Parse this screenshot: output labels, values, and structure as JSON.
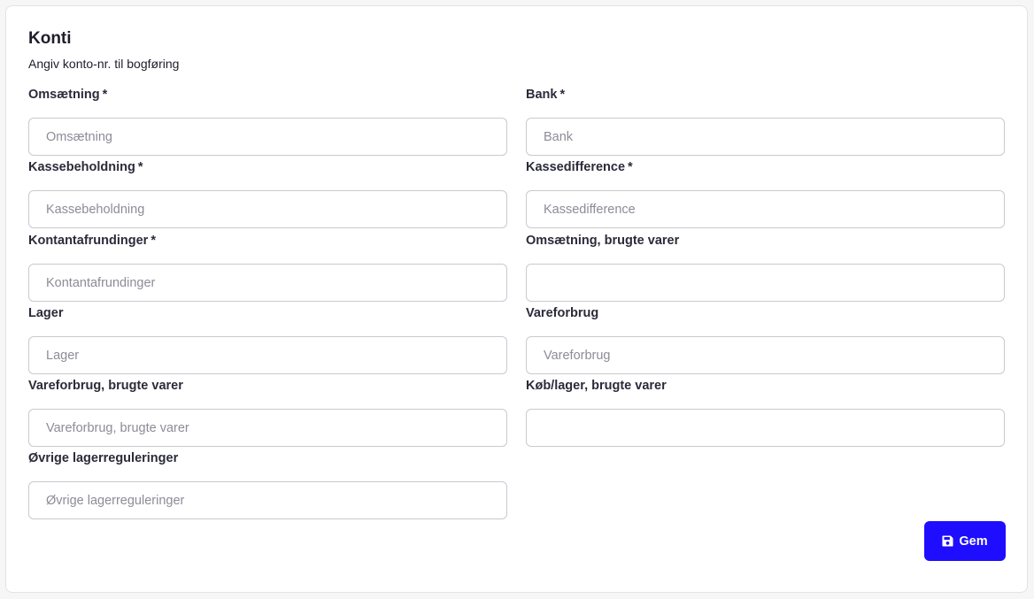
{
  "card": {
    "title": "Konti",
    "subtitle": "Angiv konto-nr. til bogføring"
  },
  "fields": {
    "omsaetning": {
      "label": "Omsætning",
      "required_mark": "*",
      "value": "",
      "placeholder": "Omsætning"
    },
    "bank": {
      "label": "Bank",
      "required_mark": "*",
      "value": "",
      "placeholder": "Bank"
    },
    "kassebeholdning": {
      "label": "Kassebeholdning",
      "required_mark": "*",
      "value": "",
      "placeholder": "Kassebeholdning"
    },
    "kassedifference": {
      "label": "Kassedifference",
      "required_mark": "*",
      "value": "",
      "placeholder": "Kassedifference"
    },
    "kontantafrundinger": {
      "label": "Kontantafrundinger",
      "required_mark": "*",
      "value": "",
      "placeholder": "Kontantafrundinger"
    },
    "omsaetning_brugte_varer": {
      "label": "Omsætning, brugte varer",
      "value": "",
      "placeholder": ""
    },
    "lager": {
      "label": "Lager",
      "value": "",
      "placeholder": "Lager"
    },
    "vareforbrug": {
      "label": "Vareforbrug",
      "value": "",
      "placeholder": "Vareforbrug"
    },
    "vareforbrug_brugte_varer": {
      "label": "Vareforbrug, brugte varer",
      "value": "",
      "placeholder": "Vareforbrug, brugte varer"
    },
    "koeb_lager_brugte_varer": {
      "label": "Køb/lager, brugte varer",
      "value": "",
      "placeholder": ""
    },
    "oevrige_lagerreguleringer": {
      "label": "Øvrige lagerreguleringer",
      "value": "",
      "placeholder": "Øvrige lagerreguleringer"
    }
  },
  "actions": {
    "save_label": "Gem",
    "save_icon": "floppy-disk-icon",
    "primary_color": "#1f0dff"
  }
}
